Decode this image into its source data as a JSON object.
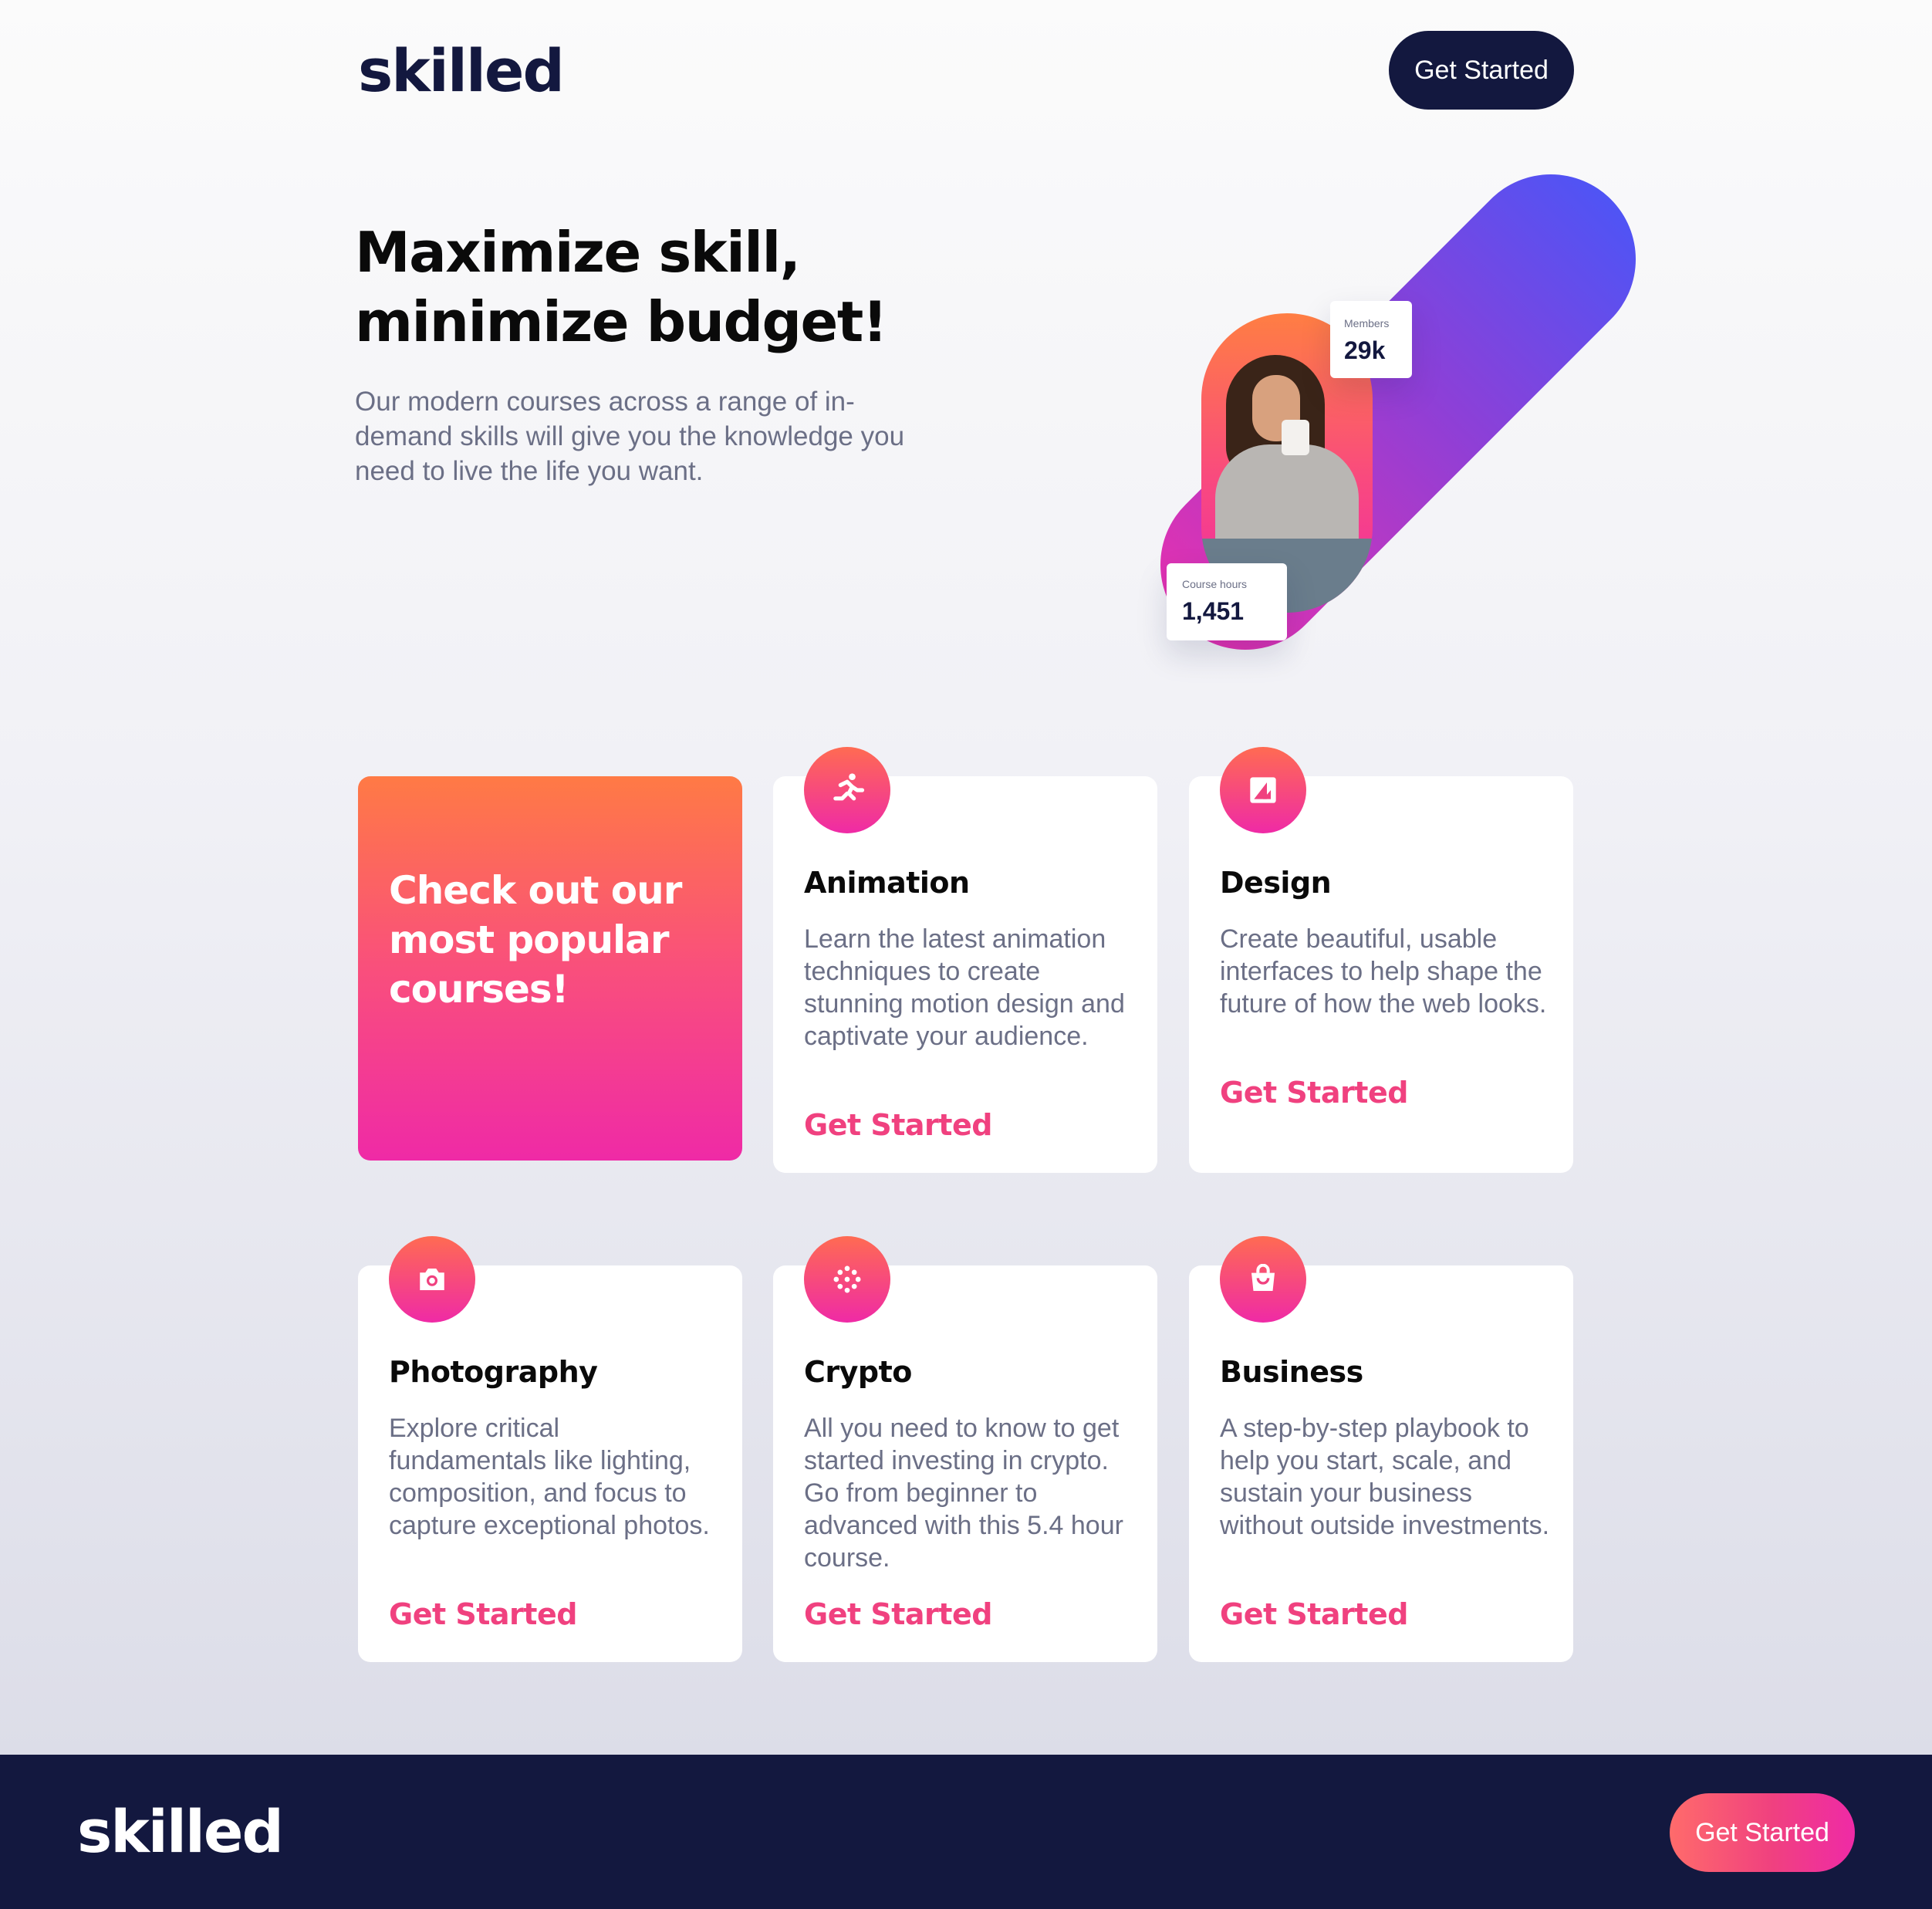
{
  "header": {
    "logo": "skilled",
    "cta_label": "Get Started"
  },
  "hero": {
    "title": "Maximize skill, minimize budget!",
    "description": "Our modern courses across a range of in-demand skills will give you the knowledge you need to live the life you want.",
    "stats": {
      "members": {
        "label": "Members",
        "value": "29k"
      },
      "course_hours": {
        "label": "Course hours",
        "value": "1,451"
      }
    }
  },
  "promo": {
    "title": "Check out our most popular courses!"
  },
  "courses": [
    {
      "title": "Animation",
      "icon": "running-icon",
      "description": "Learn the latest animation techniques to create stunning motion design and captivate your audience.",
      "link": "Get Started"
    },
    {
      "title": "Design",
      "icon": "design-icon",
      "description": "Create beautiful, usable interfaces to help shape the future of how the web looks.",
      "link": "Get Started"
    },
    {
      "title": "Photography",
      "icon": "camera-icon",
      "description": "Explore critical fundamentals like lighting, composition, and focus to capture exceptional photos.",
      "link": "Get Started"
    },
    {
      "title": "Crypto",
      "icon": "crypto-icon",
      "description": "All you need to know to get started investing in crypto. Go from beginner to advanced with this 5.4 hour course.",
      "link": "Get Started"
    },
    {
      "title": "Business",
      "icon": "shopping-bag-icon",
      "description": "A step-by-step playbook to help you start, scale, and sustain your business without outside investments.",
      "link": "Get Started"
    }
  ],
  "footer": {
    "logo": "skilled",
    "cta_label": "Get Started"
  },
  "colors": {
    "navy": "#13183f",
    "pink": "#f0417f",
    "orange": "#ff7a45",
    "magenta": "#ef2aa6",
    "violet": "#4f54f5",
    "muted_text": "#6b6f86"
  }
}
